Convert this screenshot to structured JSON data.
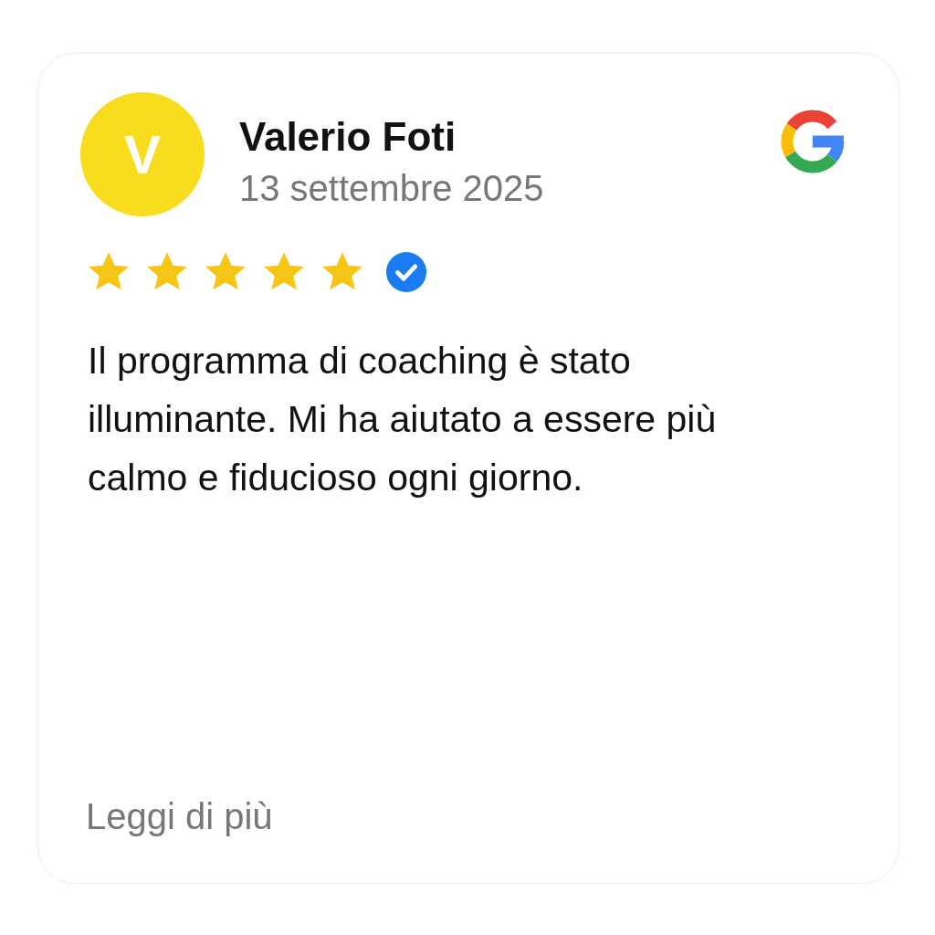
{
  "review": {
    "avatar_letter": "V",
    "author": "Valerio Foti",
    "date": "13 settembre 2025",
    "stars": 5,
    "verified": true,
    "text": "Il programma di coaching è stato illuminante. Mi ha aiutato a essere più calmo e fiducioso ogni giorno.",
    "read_more": "Leggi di più"
  }
}
